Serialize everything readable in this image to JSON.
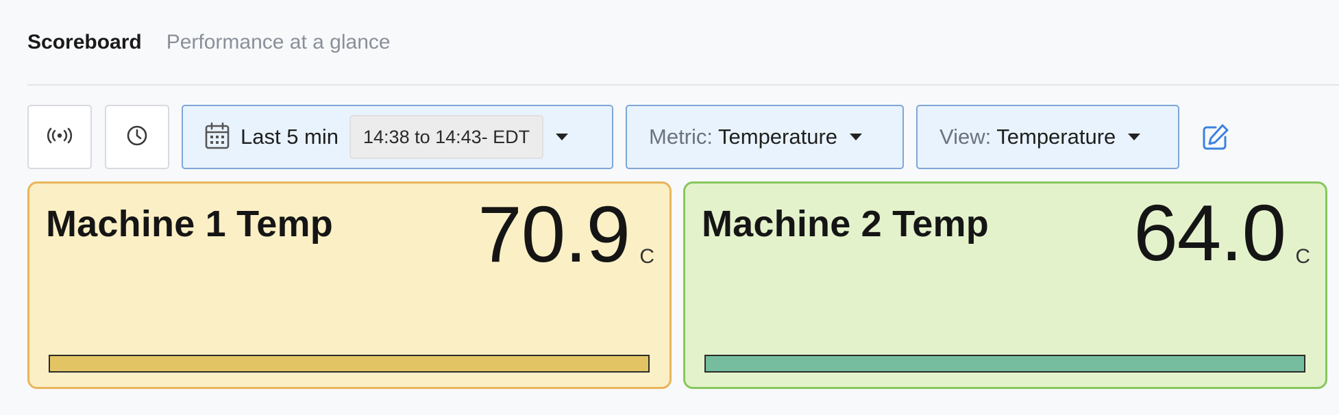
{
  "header": {
    "title": "Scoreboard",
    "subtitle": "Performance at a glance"
  },
  "toolbar": {
    "live_icon": "broadcast-icon",
    "history_icon": "clock-icon",
    "range": {
      "icon": "calendar-icon",
      "label": "Last 5 min",
      "chip": "14:38 to 14:43- EDT"
    },
    "metric": {
      "prefix": "Metric:",
      "value": "Temperature"
    },
    "view": {
      "prefix": "View:",
      "value": "Temperature"
    },
    "edit_icon": "edit-icon"
  },
  "cards": [
    {
      "title": "Machine 1 Temp",
      "value": "70.9",
      "unit": "C",
      "bar_fill_fraction": 1.0,
      "bar_color": "#e3c465",
      "bg_color": "#fbefc5",
      "border_color": "#e9b45a"
    },
    {
      "title": "Machine 2 Temp",
      "value": "64.0",
      "unit": "C",
      "bar_fill_fraction": 1.0,
      "bar_color": "#76bda0",
      "bg_color": "#e3f2cb",
      "border_color": "#86c75d"
    }
  ],
  "colors": {
    "accent_blue": "#3b82e0",
    "selector_bg": "#e9f3fd",
    "selector_border": "#7ea6d6"
  }
}
